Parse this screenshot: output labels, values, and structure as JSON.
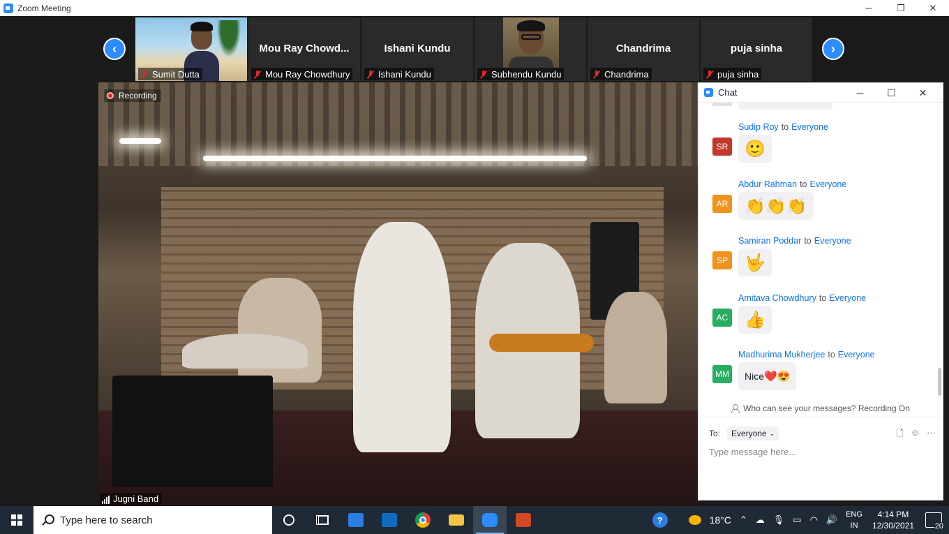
{
  "window": {
    "title": "Zoom Meeting",
    "controls": {
      "minimize": "─",
      "restore": "❐",
      "close": "✕"
    }
  },
  "gallery": {
    "prev_icon": "‹",
    "next_icon": "›",
    "tiles": [
      {
        "label": "Sumit Dutta",
        "name": ""
      },
      {
        "label": "Mou Ray Chowdhury",
        "name": "Mou  Ray  Chowd..."
      },
      {
        "label": "Ishani Kundu",
        "name": "Ishani Kundu"
      },
      {
        "label": "Subhendu Kundu",
        "name": ""
      },
      {
        "label": "Chandrima",
        "name": "Chandrima"
      },
      {
        "label": "puja sinha",
        "name": "puja sinha"
      }
    ]
  },
  "video": {
    "recording_label": "Recording",
    "speaker_label": "Jugni Band"
  },
  "chat": {
    "title": "Chat",
    "controls": {
      "minimize": "─",
      "maximize": "☐",
      "close": "✕"
    },
    "to_word": "to",
    "messages": [
      {
        "initials": "SR",
        "color": "#c0392b",
        "sender": "Sudip Roy",
        "recipient": "Everyone",
        "text": "",
        "emoji": "🙂"
      },
      {
        "initials": "AR",
        "color": "#f0931e",
        "sender": "Abdur Rahman",
        "recipient": "Everyone",
        "text": "",
        "emoji": "👏👏👏"
      },
      {
        "initials": "SP",
        "color": "#f0931e",
        "sender": "Samiran Poddar",
        "recipient": "Everyone",
        "text": "",
        "emoji": "🤟"
      },
      {
        "initials": "AC",
        "color": "#27ae60",
        "sender": "Amitava Chowdhury",
        "recipient": "Everyone",
        "text": "",
        "emoji": "👍"
      },
      {
        "initials": "MM",
        "color": "#27ae60",
        "sender": "Madhurima Mukherjee",
        "recipient": "Everyone",
        "text": "Nice",
        "emoji": "❤️😍"
      }
    ],
    "privacy_note": "Who can see your messages? Recording On",
    "to_label": "To:",
    "recipient_select": "Everyone",
    "compose_placeholder": "Type message here...",
    "icons": {
      "file": "🗋",
      "emoji": "☺",
      "more": "···"
    }
  },
  "taskbar": {
    "search_placeholder": "Type here to search",
    "weather": "18°C",
    "lang_top": "ENG",
    "lang_bottom": "IN",
    "time": "4:14 PM",
    "date": "12/30/2021",
    "notifications": "20",
    "help_icon": "?"
  },
  "colors": {
    "zoom_blue": "#2D8CFF",
    "taskbar_bg": "#202a36",
    "chat_link": "#0e72ed"
  }
}
